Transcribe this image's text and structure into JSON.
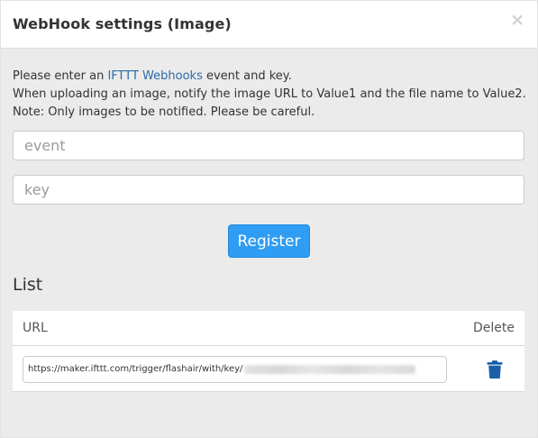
{
  "dialog": {
    "title": "WebHook settings (Image)",
    "close_glyph": "×"
  },
  "description": {
    "line1_prefix": "Please enter an ",
    "line1_link": "IFTTT Webhooks",
    "line1_suffix": " event and key.",
    "line2": "When uploading an image, notify the image URL to Value1 and the file name to Value2.",
    "line3": "Note: Only images to be notified. Please be careful."
  },
  "form": {
    "event_placeholder": "event",
    "event_value": "",
    "key_placeholder": "key",
    "key_value": "",
    "register_label": "Register"
  },
  "list": {
    "heading": "List",
    "columns": {
      "url": "URL",
      "delete": "Delete"
    },
    "rows": [
      {
        "url_visible": "https://maker.ifttt.com/trigger/flashair/with/key/",
        "delete_icon": "trash-icon"
      }
    ]
  },
  "colors": {
    "accent": "#2f9df4",
    "link": "#2b6aa6",
    "trash": "#1a5fa8",
    "background": "#ebebeb"
  }
}
